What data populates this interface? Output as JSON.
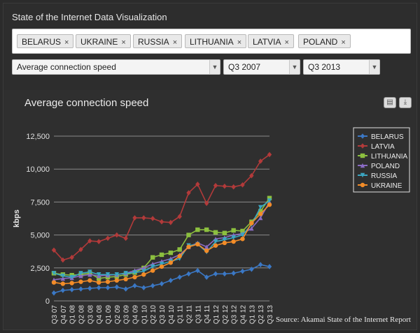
{
  "app_title": "State of the Internet Data Visualization",
  "tags": [
    {
      "label": "BELARUS"
    },
    {
      "label": "UKRAINE"
    },
    {
      "label": "RUSSIA"
    },
    {
      "label": "LITHUANIA"
    },
    {
      "label": "LATVIA"
    },
    {
      "label": "POLAND"
    }
  ],
  "tag_remove_glyph": "×",
  "metric_select": {
    "value": "Average connection speed"
  },
  "start_select": {
    "value": "Q3 2007"
  },
  "end_select": {
    "value": "Q3 2013"
  },
  "icons": {
    "print": "print-icon",
    "download": "download-icon"
  },
  "source_text": "Source: Akamai State of the Internet Report",
  "chart_data": {
    "type": "line",
    "title": "Average connection speed",
    "xlabel": "",
    "ylabel": "kbps",
    "ylim": [
      0,
      12500
    ],
    "yticks": [
      0,
      2500,
      5000,
      7500,
      10000,
      12500
    ],
    "ytick_labels": [
      "0",
      "2,500",
      "5,000",
      "7,500",
      "10,000",
      "12,500"
    ],
    "grid": true,
    "legend_position": "top-right",
    "categories": [
      "Q3 07",
      "Q4 07",
      "Q1 08",
      "Q2 08",
      "Q3 08",
      "Q4 08",
      "Q1 09",
      "Q2 09",
      "Q3 09",
      "Q4 09",
      "Q1 10",
      "Q2 10",
      "Q3 10",
      "Q4 10",
      "Q1 11",
      "Q2 11",
      "Q3 11",
      "Q4 11",
      "Q1 12",
      "Q2 12",
      "Q3 12",
      "Q4 12",
      "Q1 13",
      "Q2 13",
      "Q3 13"
    ],
    "series": [
      {
        "name": "BELARUS",
        "color": "#3b78c5",
        "marker": "diamond",
        "values": [
          600,
          800,
          850,
          900,
          950,
          1000,
          1000,
          1050,
          900,
          1150,
          1000,
          1150,
          1300,
          1550,
          1800,
          2050,
          2300,
          1800,
          2050,
          2050,
          2100,
          2250,
          2400,
          2750,
          2600
        ]
      },
      {
        "name": "LATVIA",
        "color": "#b23a3a",
        "marker": "diamond",
        "values": [
          3850,
          3100,
          3300,
          3900,
          4550,
          4500,
          4750,
          5000,
          4750,
          6300,
          6300,
          6250,
          6000,
          5950,
          6400,
          8200,
          8850,
          7400,
          8750,
          8700,
          8650,
          8800,
          9500,
          10600,
          11100
        ]
      },
      {
        "name": "LITHUANIA",
        "color": "#8cbf3f",
        "marker": "square",
        "values": [
          2100,
          2000,
          1950,
          2000,
          2100,
          1700,
          1800,
          1850,
          2000,
          2150,
          2500,
          3300,
          3500,
          3650,
          3900,
          5000,
          5400,
          5400,
          5200,
          5150,
          5350,
          5300,
          6000,
          6800,
          7800
        ]
      },
      {
        "name": "POLAND",
        "color": "#8a6bc4",
        "marker": "triangle",
        "values": [
          1600,
          1700,
          1750,
          1900,
          2000,
          1900,
          1950,
          2000,
          2100,
          2300,
          2500,
          2800,
          3000,
          3200,
          3500,
          4100,
          4400,
          4100,
          4700,
          4800,
          5000,
          5100,
          5500,
          6300,
          7500
        ]
      },
      {
        "name": "RUSSIA",
        "color": "#3ba6c2",
        "marker": "triangle-down",
        "values": [
          2100,
          1900,
          1800,
          2100,
          2200,
          2000,
          2000,
          2000,
          2100,
          2150,
          2250,
          2600,
          2800,
          3000,
          3200,
          4200,
          4300,
          3700,
          4500,
          4650,
          4800,
          5000,
          5800,
          7100,
          7600
        ]
      },
      {
        "name": "UKRAINE",
        "color": "#f28c28",
        "marker": "circle",
        "values": [
          1400,
          1300,
          1350,
          1450,
          1550,
          1400,
          1450,
          1550,
          1650,
          1800,
          2000,
          2300,
          2600,
          2900,
          3400,
          4100,
          4300,
          3800,
          4200,
          4400,
          4500,
          4700,
          5900,
          6600,
          7300
        ]
      }
    ]
  }
}
